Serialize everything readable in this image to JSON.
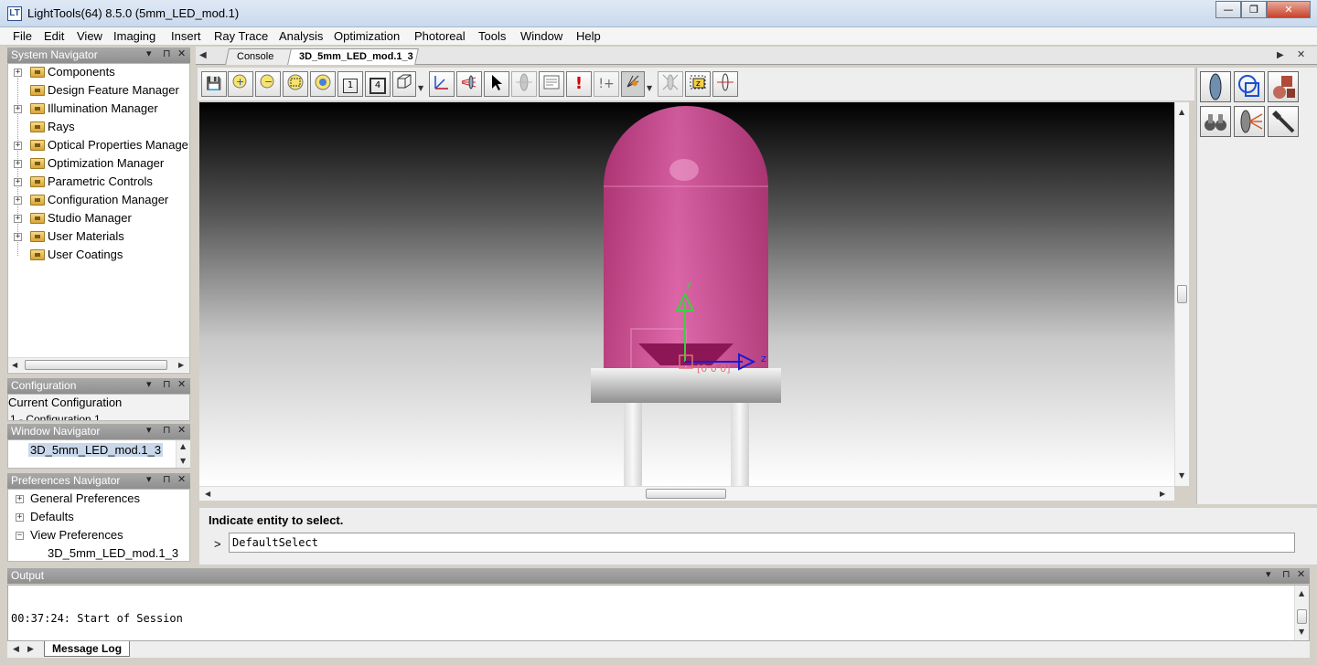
{
  "window": {
    "title": "LightTools(64) 8.5.0  (5mm_LED_mod.1)",
    "app_icon_text": "LT",
    "minimize": "—",
    "restore": "❐",
    "close": "✕"
  },
  "menu": [
    "File",
    "Edit",
    "View",
    "Imaging",
    "Insert",
    "Ray Trace",
    "Analysis",
    "Optimization",
    "Photoreal",
    "Tools",
    "Window",
    "Help"
  ],
  "system_navigator": {
    "title": "System Navigator",
    "items": [
      "Components",
      "Design Feature Manager",
      "Illumination Manager",
      "Rays",
      "Optical Properties Manage",
      "Optimization Manager",
      "Parametric Controls",
      "Configuration Manager",
      "Studio Manager",
      "User Materials",
      "User Coatings"
    ]
  },
  "configuration": {
    "title": "Configuration",
    "current_label": "Current Configuration",
    "value": "1 - Configuration 1"
  },
  "window_navigator": {
    "title": "Window Navigator",
    "item": "3D_5mm_LED_mod.1_3"
  },
  "preferences_navigator": {
    "title": "Preferences Navigator",
    "items": [
      "General Preferences",
      "Defaults",
      "View Preferences"
    ],
    "subitem": "3D_5mm_LED_mod.1_3"
  },
  "tabs": [
    "Console",
    "3D_5mm_LED_mod.1_3"
  ],
  "toolbar": {
    "page1": "1",
    "page4": "4"
  },
  "viewport": {
    "axis_y": "y",
    "axis_z": "z",
    "origin_label": "[0 0 0]"
  },
  "command": {
    "prompt_text": "Indicate entity to select.",
    "prompt_symbol": ">",
    "input_value": "DefaultSelect"
  },
  "output": {
    "title": "Output",
    "log_line": "00:37:24: Start of Session",
    "tab": "Message Log"
  },
  "colors": {
    "led_body": "#d64a94",
    "axis_y": "#3ecf3e",
    "axis_z": "#1a1ad6",
    "origin": "#e07070"
  }
}
